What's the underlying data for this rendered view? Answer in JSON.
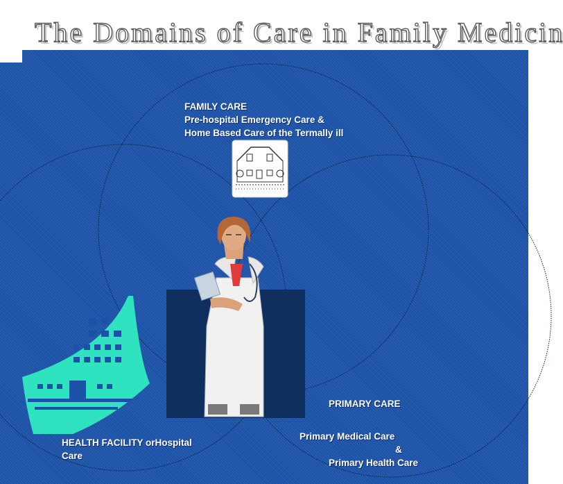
{
  "title": "The Domains of Care in Family Medicine",
  "family_care": {
    "heading": "FAMILY CARE",
    "line1": "Pre-hospital Emergency Care &",
    "line2": "Home Based Care of the Termally ill"
  },
  "primary_care": {
    "heading": "PRIMARY CARE",
    "line1": "Primary Medical Care",
    "line2": "&",
    "line3": "Primary Health Care"
  },
  "health_facility": {
    "line1": "HEALTH FACILITY orHospital",
    "line2": "Care"
  },
  "colors": {
    "background": "#1b51a6",
    "hospital_icon": "#2fe3c0",
    "doctor_panel": "#0f2f5f",
    "text": "#ffffff"
  },
  "icons": [
    "house-icon",
    "hospital-building-icon",
    "doctor-illustration"
  ]
}
